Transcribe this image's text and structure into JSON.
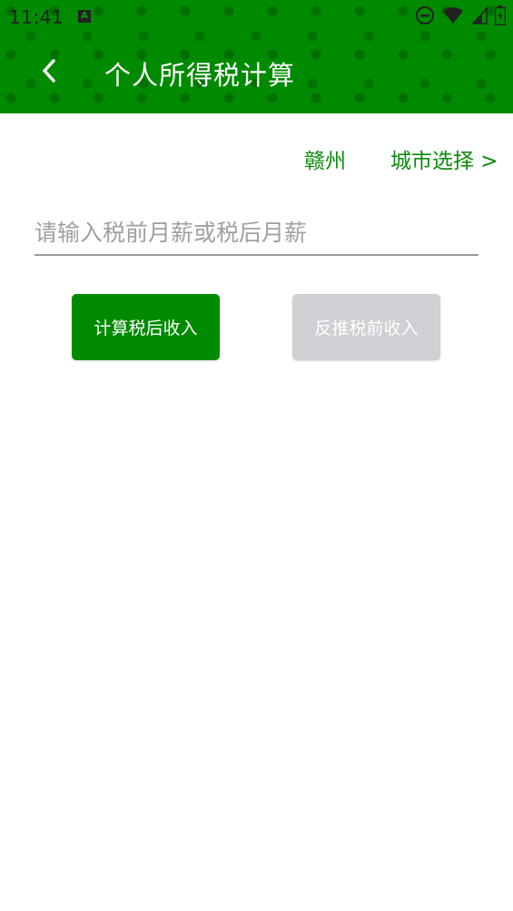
{
  "statusbar": {
    "time": "11:41",
    "a_label": "A"
  },
  "header": {
    "title": "个人所得税计算"
  },
  "city": {
    "name": "赣州",
    "select_label": "城市选择 >"
  },
  "salary": {
    "placeholder": "请输入税前月薪或税后月薪",
    "value": ""
  },
  "actions": {
    "calc_after_tax": "计算税后收入",
    "reverse_pre_tax": "反推税前收入"
  },
  "colors": {
    "primary": "#008a00",
    "disabled": "#cfcfd4",
    "city_text": "#0a8a0a"
  }
}
